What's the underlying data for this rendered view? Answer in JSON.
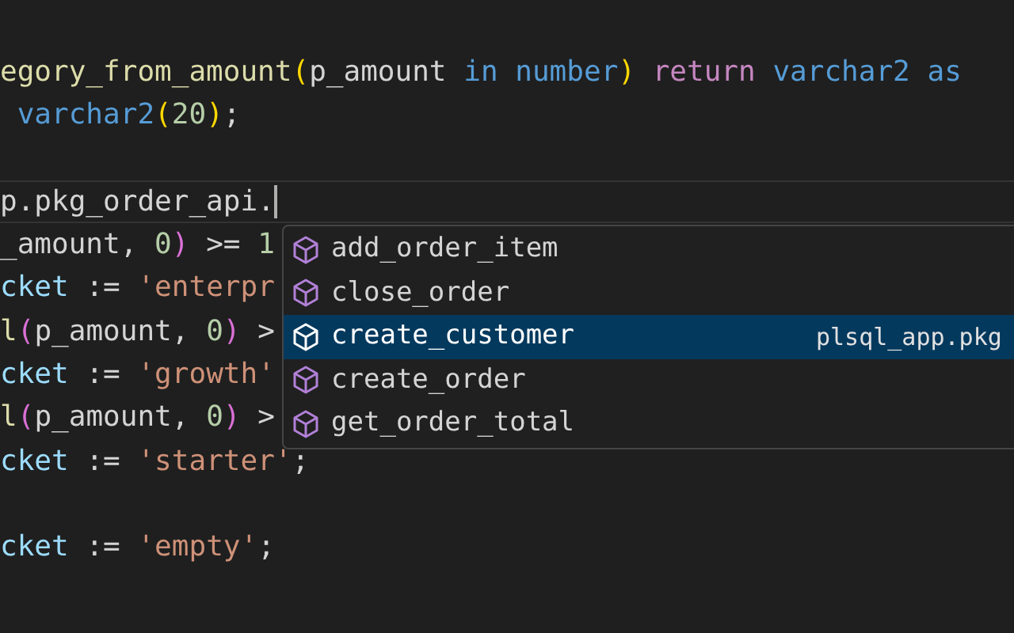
{
  "editor": {
    "lines": [
      {
        "current": false,
        "tokens": [
          {
            "text": "egory_from_amount",
            "kind": "function"
          },
          {
            "text": "(",
            "kind": "bracket1"
          },
          {
            "text": "p_amount",
            "kind": "plain"
          },
          {
            "text": " in number",
            "kind": "keyword"
          },
          {
            "text": ")",
            "kind": "bracket1"
          },
          {
            "text": " return",
            "kind": "control"
          },
          {
            "text": " varchar2 as",
            "kind": "keyword"
          }
        ]
      },
      {
        "current": false,
        "tokens": [
          {
            "text": " varchar2",
            "kind": "keyword"
          },
          {
            "text": "(",
            "kind": "bracket1"
          },
          {
            "text": "20",
            "kind": "number"
          },
          {
            "text": ")",
            "kind": "bracket1"
          },
          {
            "text": ";",
            "kind": "plain"
          }
        ]
      },
      {
        "current": false
      },
      {
        "current": true,
        "tokens": [
          {
            "text": "p.pkg_order_api.",
            "kind": "plain"
          }
        ]
      },
      {
        "current": false,
        "tokens": [
          {
            "text": "_amount",
            "kind": "plain"
          },
          {
            "text": ", ",
            "kind": "plain"
          },
          {
            "text": "0",
            "kind": "number"
          },
          {
            "text": ")",
            "kind": "bracket2"
          },
          {
            "text": " >= ",
            "kind": "plain"
          },
          {
            "text": "1",
            "kind": "number"
          }
        ]
      },
      {
        "current": false,
        "tokens": [
          {
            "text": "cket",
            "kind": "variable"
          },
          {
            "text": " := ",
            "kind": "plain"
          },
          {
            "text": "'enterpr",
            "kind": "string"
          }
        ]
      },
      {
        "current": false,
        "tokens": [
          {
            "text": "l",
            "kind": "function"
          },
          {
            "text": "(",
            "kind": "bracket2"
          },
          {
            "text": "p_amount",
            "kind": "plain"
          },
          {
            "text": ", ",
            "kind": "plain"
          },
          {
            "text": "0",
            "kind": "number"
          },
          {
            "text": ")",
            "kind": "bracket2"
          },
          {
            "text": " >",
            "kind": "plain"
          }
        ]
      },
      {
        "current": false,
        "tokens": [
          {
            "text": "cket",
            "kind": "variable"
          },
          {
            "text": " := ",
            "kind": "plain"
          },
          {
            "text": "'growth'",
            "kind": "string"
          }
        ]
      },
      {
        "current": false,
        "tokens": [
          {
            "text": "l",
            "kind": "function"
          },
          {
            "text": "(",
            "kind": "bracket2"
          },
          {
            "text": "p_amount",
            "kind": "plain"
          },
          {
            "text": ", ",
            "kind": "plain"
          },
          {
            "text": "0",
            "kind": "number"
          },
          {
            "text": ")",
            "kind": "bracket2"
          },
          {
            "text": " >",
            "kind": "plain"
          }
        ]
      },
      {
        "current": false,
        "tokens": [
          {
            "text": "cket",
            "kind": "variable"
          },
          {
            "text": " := ",
            "kind": "plain"
          },
          {
            "text": "'starter'",
            "kind": "string"
          },
          {
            "text": ";",
            "kind": "plain"
          }
        ]
      },
      {
        "current": false
      },
      {
        "current": false,
        "tokens": [
          {
            "text": "cket",
            "kind": "variable"
          },
          {
            "text": " := ",
            "kind": "plain"
          },
          {
            "text": "'empty'",
            "kind": "string"
          },
          {
            "text": ";",
            "kind": "plain"
          }
        ]
      }
    ]
  },
  "suggestions": [
    {
      "label": "add_order_item",
      "selected": false
    },
    {
      "label": "close_order",
      "selected": false
    },
    {
      "label": "create_customer",
      "selected": true,
      "detail": "plsql_app.pkg"
    },
    {
      "label": "create_order",
      "selected": false
    },
    {
      "label": "get_order_total",
      "selected": false
    }
  ]
}
